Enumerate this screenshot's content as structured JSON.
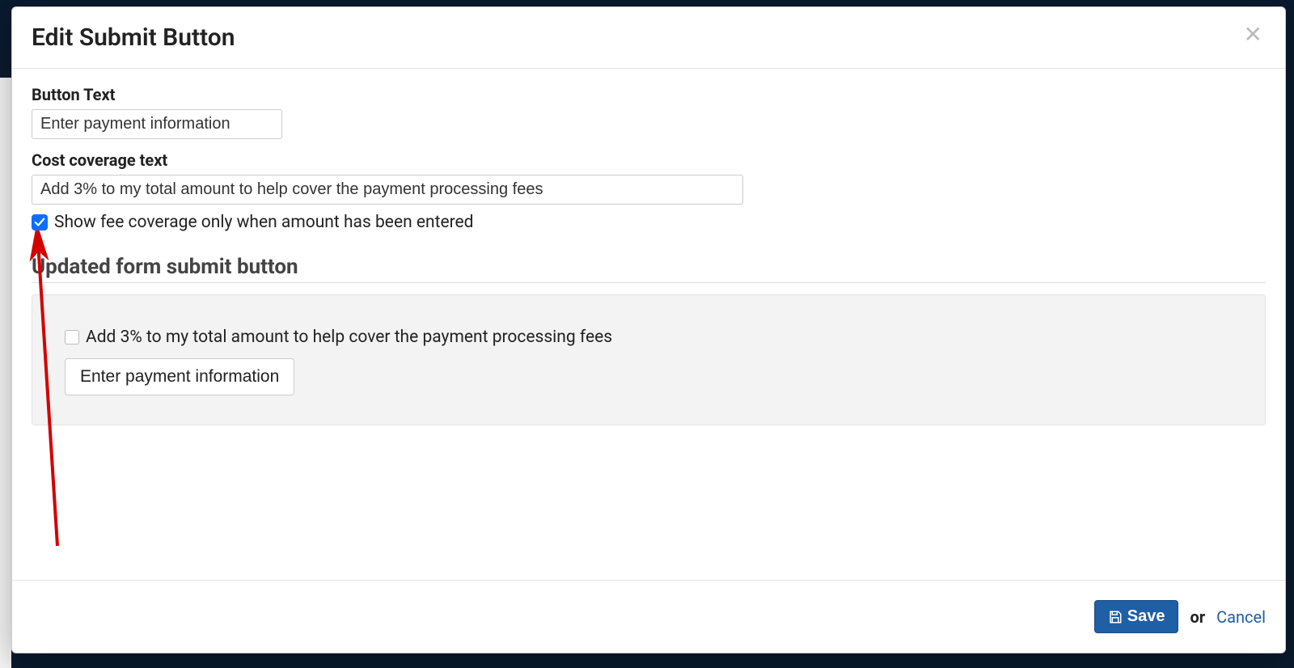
{
  "modal": {
    "title": "Edit Submit Button",
    "fields": {
      "button_text": {
        "label": "Button Text",
        "value": "Enter payment information"
      },
      "cost_coverage_text": {
        "label": "Cost coverage text",
        "value": "Add 3% to my total amount to help cover the payment processing fees"
      },
      "show_fee_only_when_amount": {
        "label": "Show fee coverage only when amount has been entered",
        "checked": true
      }
    },
    "preview": {
      "heading": "Updated form submit button",
      "checkbox_label": "Add 3% to my total amount to help cover the payment processing fees",
      "checkbox_checked": false,
      "button_label": "Enter payment information"
    },
    "footer": {
      "save_label": "Save",
      "or_label": "or",
      "cancel_label": "Cancel"
    }
  },
  "annotation": {
    "type": "arrow",
    "color": "#d40000",
    "points_to": "show-fee-coverage-checkbox"
  }
}
